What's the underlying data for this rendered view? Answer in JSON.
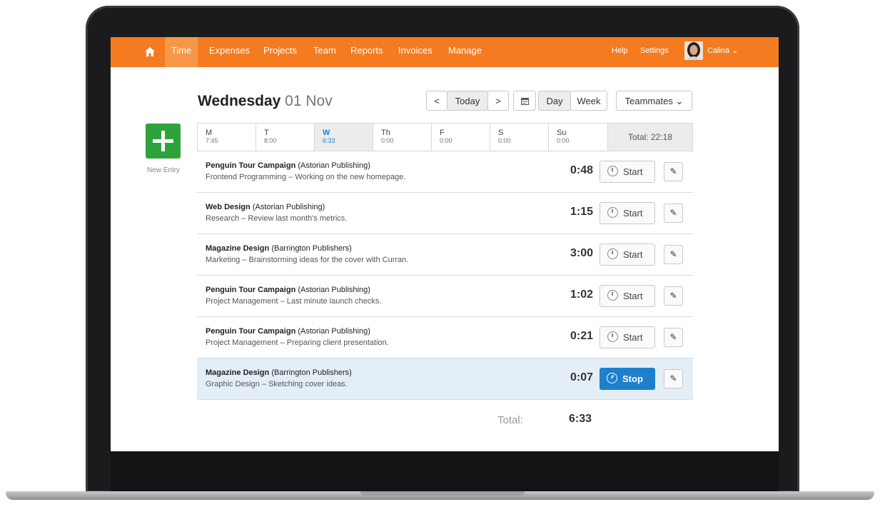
{
  "nav": {
    "items": [
      "Time",
      "Expenses",
      "Projects",
      "Team",
      "Reports",
      "Invoices",
      "Manage"
    ],
    "help": "Help",
    "settings": "Settings",
    "user": "Calina ⌄",
    "home_icon": "home-icon",
    "accent": "#f47b20"
  },
  "header": {
    "day": "Wednesday",
    "date": "01 Nov",
    "prev": "<",
    "today": "Today",
    "next": ">",
    "calendar_icon": "calendar-icon",
    "day_view": "Day",
    "week_view": "Week",
    "teammates": "Teammates ⌄"
  },
  "new_entry": {
    "label": "New Entry",
    "icon": "plus-icon",
    "color": "#2fa33b"
  },
  "days": [
    {
      "name": "M",
      "value": "7:45"
    },
    {
      "name": "T",
      "value": "8:00"
    },
    {
      "name": "W",
      "value": "6:33"
    },
    {
      "name": "Th",
      "value": "0:00"
    },
    {
      "name": "F",
      "value": "0:00"
    },
    {
      "name": "S",
      "value": "0:00"
    },
    {
      "name": "Su",
      "value": "0:00"
    }
  ],
  "week_total": "Total: 22:18",
  "entries": [
    {
      "project": "Penguin Tour Campaign",
      "client": "(Astorian Publishing)",
      "task": "Frontend Programming",
      "note": "Working on the new homepage.",
      "duration": "0:48",
      "action": "Start"
    },
    {
      "project": "Web Design",
      "client": "(Astorian Publishing)",
      "task": "Research",
      "note": "Review last month's metrics.",
      "duration": "1:15",
      "action": "Start"
    },
    {
      "project": "Magazine Design",
      "client": "(Barrington Publishers)",
      "task": "Marketing",
      "note": "Brainstorming ideas for the cover with Curran.",
      "duration": "3:00",
      "action": "Start"
    },
    {
      "project": "Penguin Tour Campaign",
      "client": "(Astorian Publishing)",
      "task": "Project Management",
      "note": "Last minute launch checks.",
      "duration": "1:02",
      "action": "Start"
    },
    {
      "project": "Penguin Tour Campaign",
      "client": "(Astorian Publishing)",
      "task": "Project Management",
      "note": "Preparing client presentation.",
      "duration": "0:21",
      "action": "Start"
    },
    {
      "project": "Magazine Design",
      "client": "(Barrington Publishers)",
      "task": "Graphic Design",
      "note": "Sketching cover ideas.",
      "duration": "0:07",
      "action": "Stop"
    }
  ],
  "separator": "–",
  "edit_icon": "pencil-icon",
  "footer": {
    "total_label": "Total:",
    "total_value": "6:33"
  }
}
